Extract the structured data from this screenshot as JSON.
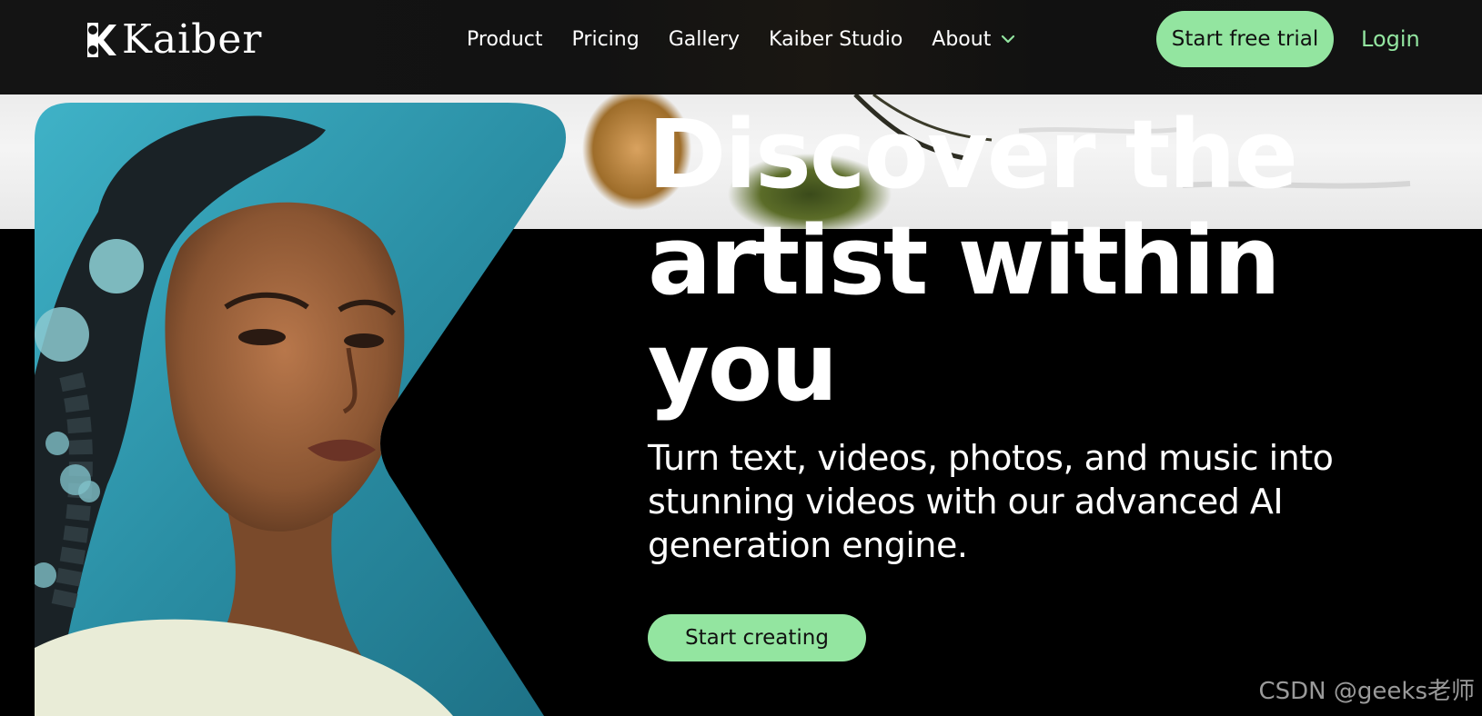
{
  "brand": {
    "name": "Kaiber"
  },
  "nav": {
    "links": [
      "Product",
      "Pricing",
      "Gallery",
      "Kaiber Studio"
    ],
    "about_label": "About",
    "trial_label": "Start free trial",
    "login_label": "Login"
  },
  "hero": {
    "title": "Discover the artist within you",
    "subtitle": "Turn text, videos, photos, and music into stunning videos with our advanced AI generation engine.",
    "cta_label": "Start creating"
  },
  "watermark": "CSDN @geeks老师",
  "colors": {
    "accent": "#93e5a0",
    "background": "#000000",
    "nav_background": "#121212",
    "text": "#ffffff"
  },
  "icons": [
    "kaiber-logo-icon",
    "chevron-down-icon"
  ]
}
